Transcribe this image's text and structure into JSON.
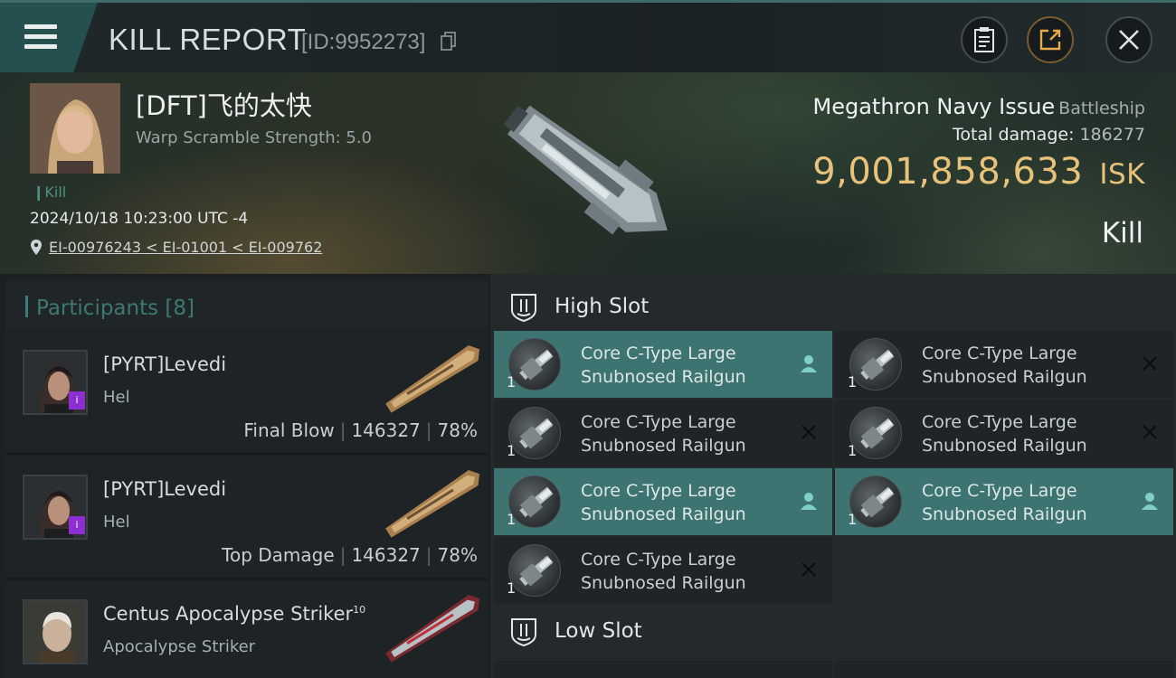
{
  "header": {
    "title": "KILL REPORT",
    "report_id": "[ID:9952273]"
  },
  "victim": {
    "name": "[DFT]飞的太快",
    "warp_scramble": "Warp Scramble Strength: 5.0",
    "kill_tag": "Kill",
    "date": "2024/10/18 10:23:00 UTC -4",
    "location": "EI-00976243 < EI-01001 < EI-009762",
    "ship_name": "Megathron Navy Issue",
    "ship_class": "Battleship",
    "total_damage_label": "Total damage:",
    "total_damage_value": "186277",
    "isk_value": "9,001,858,633",
    "isk_unit": "ISK",
    "result_label": "Kill"
  },
  "participants": {
    "header": "Participants [8]",
    "rows": [
      {
        "name": "[PYRT]Levedi",
        "ship": "Hel",
        "label": "Final Blow",
        "damage": "146327",
        "percent": "78%",
        "badge": "i"
      },
      {
        "name": "[PYRT]Levedi",
        "ship": "Hel",
        "label": "Top Damage",
        "damage": "146327",
        "percent": "78%",
        "badge": "i"
      },
      {
        "name": "Centus Apocalypse Striker",
        "name_sup": "10",
        "ship": "Apocalypse Striker"
      }
    ]
  },
  "slots": {
    "high_slot_label": "High Slot",
    "low_slot_label": "Low Slot",
    "high_modules": [
      {
        "name_line1": "Core C-Type Large",
        "name_line2": "Snubnosed Railgun",
        "qty": "1",
        "status": "fitted"
      },
      {
        "name_line1": "Core C-Type Large",
        "name_line2": "Snubnosed Railgun",
        "qty": "1",
        "status": "destroyed"
      },
      {
        "name_line1": "Core C-Type Large",
        "name_line2": "Snubnosed Railgun",
        "qty": "1",
        "status": "destroyed"
      },
      {
        "name_line1": "Core C-Type Large",
        "name_line2": "Snubnosed Railgun",
        "qty": "1",
        "status": "destroyed"
      },
      {
        "name_line1": "Core C-Type Large",
        "name_line2": "Snubnosed Railgun",
        "qty": "1",
        "status": "fitted"
      },
      {
        "name_line1": "Core C-Type Large",
        "name_line2": "Snubnosed Railgun",
        "qty": "1",
        "status": "fitted"
      },
      {
        "name_line1": "Core C-Type Large",
        "name_line2": "Snubnosed Railgun",
        "qty": "1",
        "status": "destroyed"
      }
    ]
  },
  "colors": {
    "accent_teal": "#3d7471",
    "isk_gold": "#e6c27a",
    "badge_purple": "#8d2fd0"
  },
  "icons": [
    "menu-icon",
    "copy-icon",
    "clipboard-icon",
    "share-icon",
    "close-icon",
    "location-pin-icon",
    "shield-slot-icon",
    "pilot-fitted-icon",
    "destroyed-x-icon"
  ]
}
